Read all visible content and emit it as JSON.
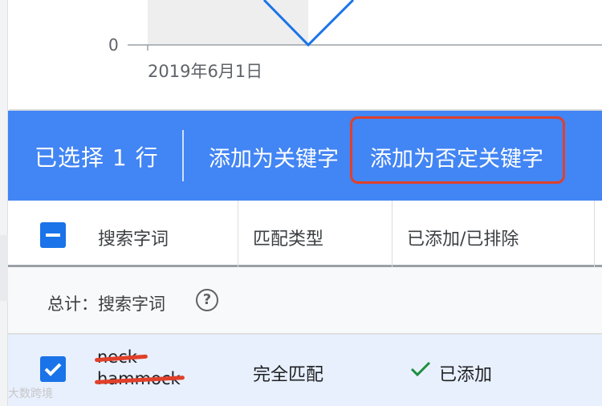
{
  "chart": {
    "y_tick": "0",
    "x_tick": "2019年6月1日",
    "line_color": "#1a73e8"
  },
  "action_bar": {
    "selected_label": "已选择 1 行",
    "add_keyword": "添加为关键字",
    "add_negative_keyword": "添加为否定关键字",
    "background": "#4285f4",
    "highlight_color": "#e0402a"
  },
  "table": {
    "headers": [
      "搜索字词",
      "匹配类型",
      "已添加/已排除"
    ],
    "total_label": "总计：搜索字词",
    "rows": [
      {
        "term_line1": "neck",
        "term_line2": "hammock",
        "match_type": "完全匹配",
        "status": "已添加"
      }
    ]
  },
  "watermark": "大数跨境"
}
